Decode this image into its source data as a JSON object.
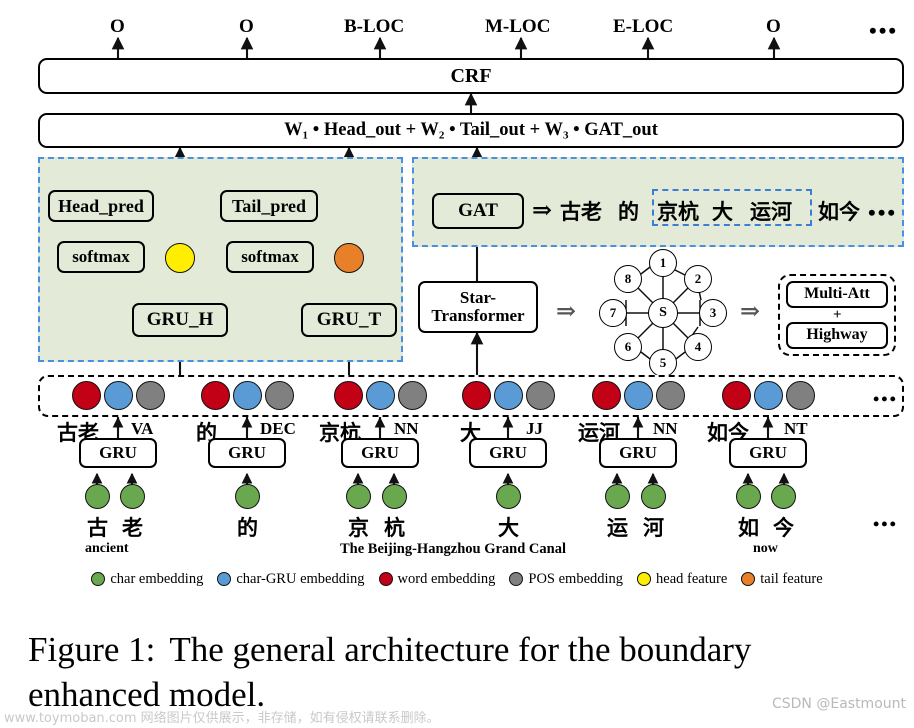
{
  "figure": {
    "caption_line1": "Figure 1:",
    "caption_line2": "The general architecture for the boundary",
    "caption_line3": "enhanced model."
  },
  "output_tags": {
    "labels": [
      "O",
      "O",
      "B-LOC",
      "M-LOC",
      "E-LOC",
      "O"
    ],
    "ellipsis": "•••"
  },
  "layers": {
    "crf": "CRF",
    "fusion": "W₁ • Head_out + W₂ • Tail_out + W₃ • GAT_out"
  },
  "boundary_module": {
    "head_pred": "Head_pred",
    "tail_pred": "Tail_pred",
    "softmax_head": "softmax",
    "softmax_tail": "softmax",
    "gru_h": "GRU_H",
    "gru_t": "GRU_T",
    "head_feature_color": "#ffee00",
    "tail_feature_color": "#e8802a"
  },
  "gat_module": {
    "gat": "GAT",
    "implies": "⇒",
    "sentence_tokens": [
      "古老",
      "的",
      "京杭",
      "大",
      "运河",
      "如今"
    ],
    "sentence_ellipsis": "•••",
    "highlighted_span": [
      "京杭",
      "大",
      "运河"
    ]
  },
  "star_module": {
    "star_transformer_line1": "Star-",
    "star_transformer_line2": "Transformer",
    "implies": "⇒",
    "graph_nodes": [
      "1",
      "2",
      "3",
      "4",
      "5",
      "6",
      "7",
      "8"
    ],
    "graph_center": "S",
    "multi_att": "Multi-Att",
    "plus": "+",
    "highway": "Highway"
  },
  "embedding_row": {
    "ellipsis": "•••",
    "dot_colors": {
      "word": "#c20016",
      "char_gru": "#5b9bd5",
      "pos": "#808080",
      "char": "#6aa84f"
    }
  },
  "words": [
    {
      "word": "古老",
      "pos": "VA",
      "gru": "GRU",
      "chars": [
        "古",
        "老"
      ],
      "gloss": "ancient"
    },
    {
      "word": "的",
      "pos": "DEC",
      "gru": "GRU",
      "chars": [
        "的"
      ],
      "gloss": ""
    },
    {
      "word": "京杭",
      "pos": "NN",
      "gru": "GRU",
      "chars": [
        "京",
        "杭"
      ],
      "gloss": ""
    },
    {
      "word": "大",
      "pos": "JJ",
      "gru": "GRU",
      "chars": [
        "大"
      ],
      "gloss": ""
    },
    {
      "word": "运河",
      "pos": "NN",
      "gru": "GRU",
      "chars": [
        "运",
        "河"
      ],
      "gloss": ""
    },
    {
      "word": "如今",
      "pos": "NT",
      "gru": "GRU",
      "chars": [
        "如",
        "今"
      ],
      "gloss": "now"
    }
  ],
  "glosses": {
    "span_gloss": "The Beijing-Hangzhou Grand Canal",
    "ellipsis": "•••"
  },
  "legend": [
    {
      "label": "char embedding",
      "color": "#6aa84f"
    },
    {
      "label": "char-GRU embedding",
      "color": "#5b9bd5"
    },
    {
      "label": "word embedding",
      "color": "#c20016"
    },
    {
      "label": "POS embedding",
      "color": "#808080"
    },
    {
      "label": "head feature",
      "color": "#ffee00"
    },
    {
      "label": "tail feature",
      "color": "#e8802a"
    }
  ],
  "watermarks": {
    "left": "www.toymoban.com 网络图片仅供展示，非存储，如有侵权请联系删除。",
    "right": "CSDN @Eastmount"
  }
}
